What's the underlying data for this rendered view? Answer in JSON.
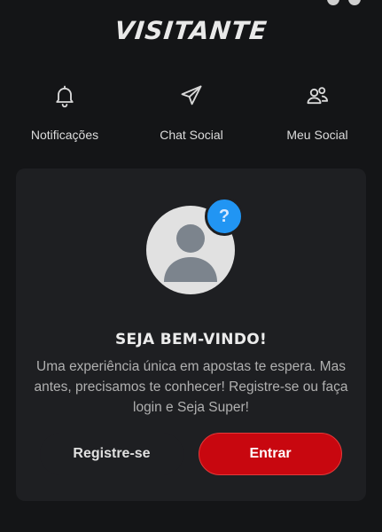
{
  "header": {
    "title": "VISITANTE"
  },
  "social_nav": {
    "items": [
      {
        "label": "Notificações",
        "icon": "bell-icon"
      },
      {
        "label": "Chat Social",
        "icon": "send-icon"
      },
      {
        "label": "Meu Social",
        "icon": "users-icon"
      }
    ]
  },
  "welcome_card": {
    "badge": "?",
    "title": "SEJA BEM-VINDO!",
    "text": "Uma experiência única em apostas te espera. Mas antes, precisamos te conhecer! Registre-se ou faça login e Seja Super!",
    "register_label": "Registre-se",
    "login_label": "Entrar"
  },
  "colors": {
    "accent_red": "#c8070f",
    "badge_blue": "#2195f3",
    "background": "#141517",
    "card": "#1e1f22"
  }
}
